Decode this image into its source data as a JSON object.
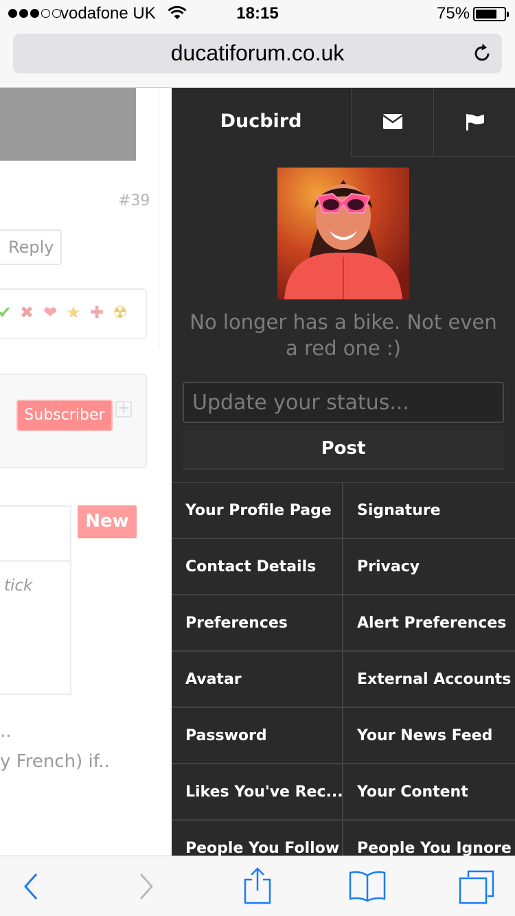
{
  "status_bar": {
    "carrier": "vodafone UK",
    "time": "18:15",
    "battery_percent": "75%",
    "battery_level": 0.75,
    "signal_bars": 3,
    "signal_total": 5
  },
  "browser": {
    "url": "ducatiforum.co.uk",
    "reload_icon": "reload-icon"
  },
  "page": {
    "post_number": "#39",
    "reply_label": "Reply",
    "subscriber_label": "Subscriber",
    "plus_label": "+",
    "new_label": "New",
    "box_text": "tick",
    "ellipsis": "..",
    "excerpt": "y French) if..",
    "reaction_icons": [
      "check-icon",
      "cross-icon",
      "heart-icon",
      "star-icon",
      "target-icon",
      "hazard-icon"
    ]
  },
  "panel": {
    "username": "Ducbird",
    "mail_icon": "envelope-icon",
    "flag_icon": "flag-icon",
    "bio": "No longer has a bike. Not even a red one :)",
    "status_placeholder": "Update your status...",
    "post_label": "Post",
    "menu": [
      [
        "Your Profile Page",
        "Signature"
      ],
      [
        "Contact Details",
        "Privacy"
      ],
      [
        "Preferences",
        "Alert Preferences"
      ],
      [
        "Avatar",
        "External Accounts"
      ],
      [
        "Password",
        "Your News Feed"
      ],
      [
        "Likes You've Rec...",
        "Your Content"
      ],
      [
        "People You Follow",
        "People You Ignore"
      ]
    ]
  },
  "toolbar": {
    "back_icon": "back-chevron-icon",
    "forward_icon": "forward-chevron-icon",
    "share_icon": "share-icon",
    "bookmarks_icon": "bookmarks-icon",
    "tabs_icon": "tabs-icon"
  },
  "colors": {
    "panel_bg": "#2a2a2a",
    "accent_pink": "#ff8e8e",
    "ios_blue": "#1a7cf5"
  }
}
